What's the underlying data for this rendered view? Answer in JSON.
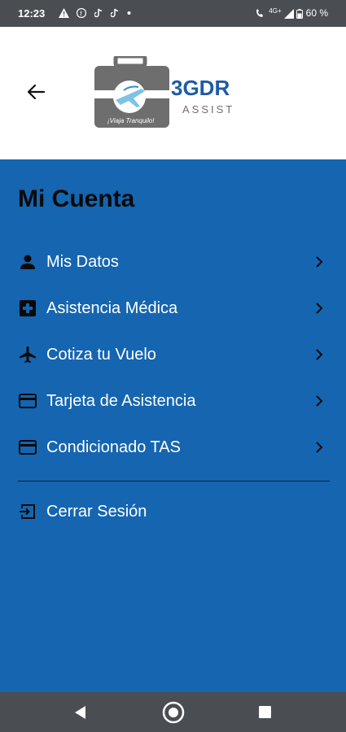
{
  "status_bar": {
    "time": "12:23",
    "left_icons": [
      "warning-icon",
      "facebook-icon",
      "tiktok-icon",
      "tiktok-icon",
      "dot-icon"
    ],
    "right_text": "4G+ ◢ 60 %",
    "battery": "60 %"
  },
  "header": {
    "logo_brand": "3GDR",
    "logo_sub": "ASSIST",
    "logo_tagline": "¡Viaja Tranquilo!"
  },
  "page": {
    "title": "Mi Cuenta"
  },
  "menu": {
    "items": [
      {
        "label": "Mis Datos",
        "icon": "person-icon"
      },
      {
        "label": "Asistencia Médica",
        "icon": "medical-plus-icon"
      },
      {
        "label": "Cotiza tu Vuelo",
        "icon": "airplane-icon"
      },
      {
        "label": "Tarjeta de Asistencia",
        "icon": "credit-card-icon"
      },
      {
        "label": "Condicionado TAS",
        "icon": "credit-card-icon"
      }
    ],
    "logout": {
      "label": "Cerrar Sesión",
      "icon": "logout-icon"
    }
  },
  "colors": {
    "primary": "#1565b0",
    "header_bg": "#ffffff",
    "system_bar": "#4a4d52",
    "text_dark": "#0a0a0a"
  }
}
